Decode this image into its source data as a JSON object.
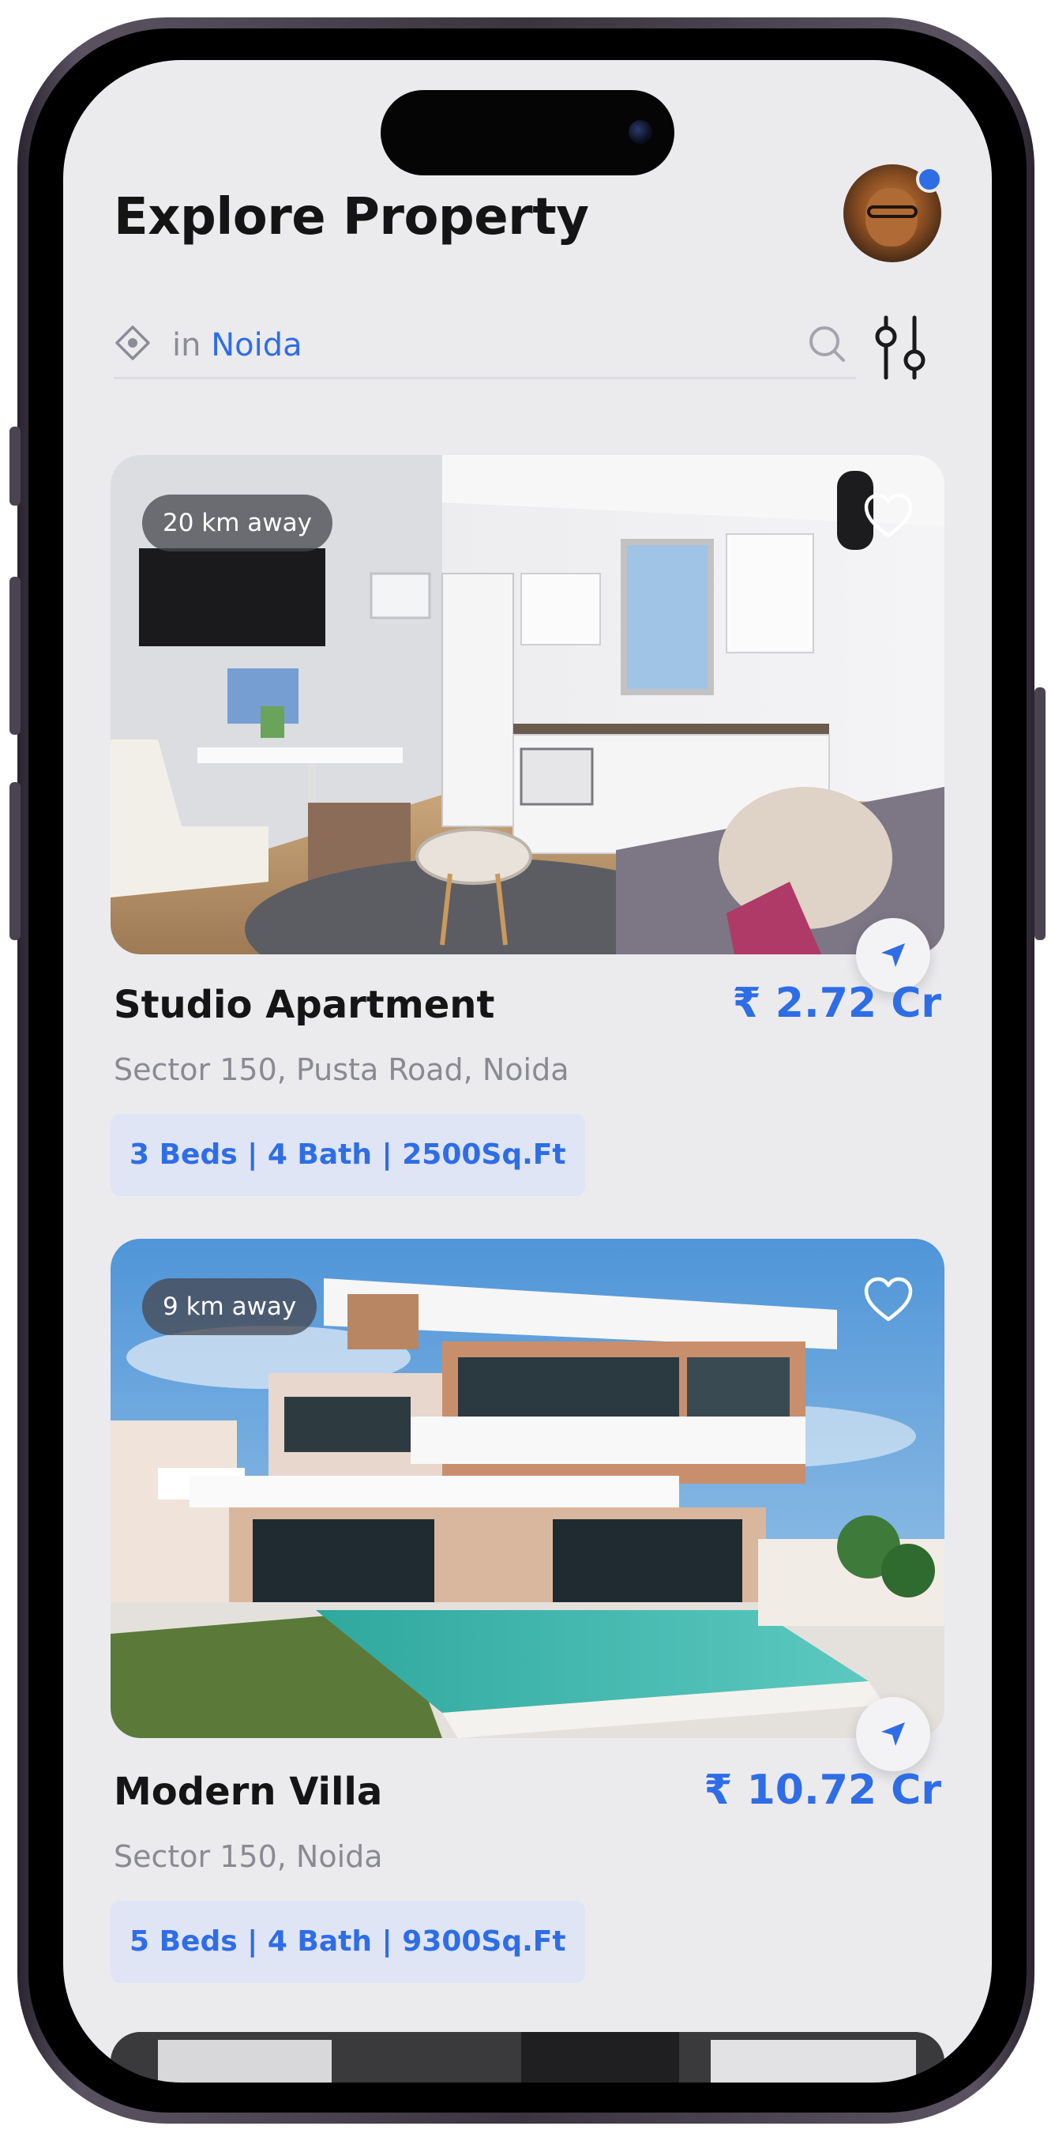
{
  "header": {
    "title": "Explore Property"
  },
  "location": {
    "prefix": "in",
    "city": "Noida"
  },
  "listings": [
    {
      "distance": "20 km away",
      "title": "Studio Apartment",
      "price": "₹ 2.72 Cr",
      "address": "Sector 150, Pusta Road, Noida",
      "specs": "3 Beds | 4 Bath | 2500Sq.Ft"
    },
    {
      "distance": "9 km away",
      "title": "Modern Villa",
      "price": "₹ 10.72 Cr",
      "address": "Sector 150, Noida",
      "specs": "5 Beds | 4 Bath | 9300Sq.Ft"
    }
  ],
  "colors": {
    "accent": "#2f6de6",
    "background": "#ebebee",
    "spec_pill_bg": "#dfe5f4",
    "title_text": "#151515",
    "secondary_text": "#8a8a92"
  },
  "icons": {
    "location": "location-pin-icon",
    "search": "search-icon",
    "filter": "filter-sliders-icon",
    "favorite": "heart-icon",
    "navigate": "navigation-arrow-icon"
  }
}
